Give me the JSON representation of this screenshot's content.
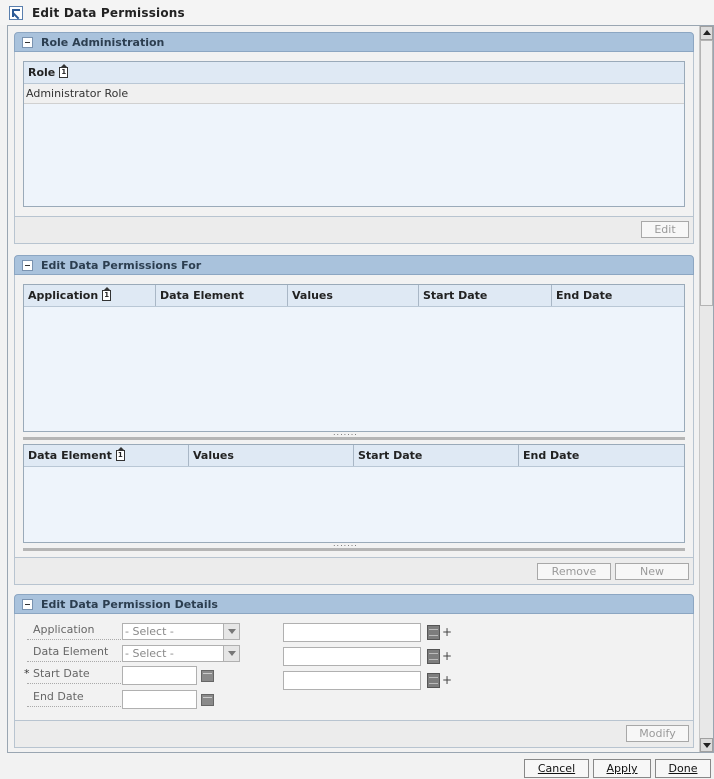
{
  "window": {
    "title": "Edit Data Permissions"
  },
  "role_admin": {
    "title": "Role Administration",
    "column": "Role",
    "sort_badge": "1",
    "rows": [
      "Administrator Role"
    ],
    "edit_label": "Edit"
  },
  "permissions_for": {
    "title": "Edit Data Permissions For",
    "columns": [
      "Application",
      "Data Element",
      "Values",
      "Start Date",
      "End Date"
    ],
    "sort_badge": "1",
    "sub_columns": [
      "Data Element",
      "Values",
      "Start Date",
      "End Date"
    ],
    "remove_label": "Remove",
    "new_label": "New"
  },
  "details": {
    "title": "Edit Data Permission Details",
    "application_label": "Application",
    "data_element_label": "Data Element",
    "start_date_label": "Start Date",
    "end_date_label": "End Date",
    "required_mark": "*",
    "application_select": "- Select -",
    "data_element_select": "- Select -",
    "modify_label": "Modify"
  },
  "footer": {
    "cancel_label": "Cancel",
    "apply_label": "Apply",
    "done_label": "Done"
  }
}
